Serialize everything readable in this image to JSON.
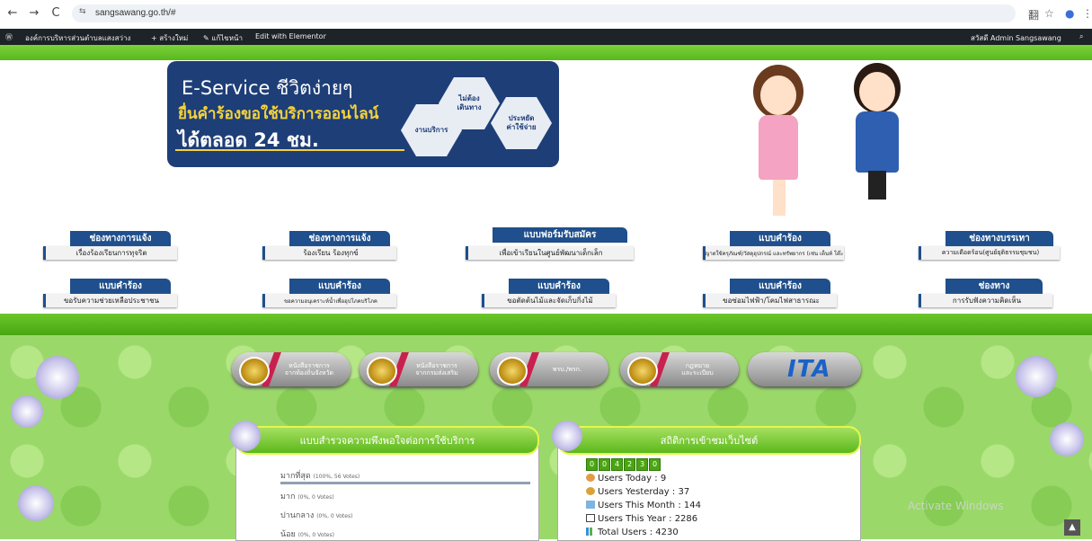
{
  "browser": {
    "url": "sangsawang.go.th/#",
    "back_icon": "←",
    "forward_icon": "→",
    "reload_icon": "C",
    "site_info_icon": "⇆",
    "translate_icon": "翻",
    "star_icon": "☆",
    "profile_icon": "●",
    "menu_icon": "⋮"
  },
  "adminbar": {
    "wp_icon": "Ⓦ",
    "site_name": "องค์การบริหารส่วนตำบลแสงสว่าง",
    "new_label": "+ สร้างใหม่",
    "edit_label": "✎ แก้ไขหน้า",
    "elementor_label": "Edit with Elementor",
    "howdy": "สวัสดี Admin Sangsawang",
    "search_icon": "⌕"
  },
  "banner": {
    "line1": "E-Service  ชีวิตง่ายๆ",
    "line2": "ยื่นคำร้องขอใช้บริการออนไลน์",
    "line3": "ได้ตลอด 24 ชม.",
    "hex1": "งานบริการ",
    "hex2": "ไม่ต้อง\nเดินทาง",
    "hex3": "ประหยัด\nค่าใช้จ่าย"
  },
  "menu": [
    {
      "top": "ช่องทางการแจ้ง",
      "bottom": "เรื่องร้องเรียนการทุจริต"
    },
    {
      "top": "ช่องทางการแจ้ง",
      "bottom": "ร้องเรียน ร้องทุกข์"
    },
    {
      "top": "แบบฟอร์มรับสมัคร",
      "bottom": "เพื่อเข้าเรียนในศูนย์พัฒนาเด็กเล็ก"
    },
    {
      "top": "แบบคำร้อง",
      "bottom": "ขออนุญาตใช้ครุภัณฑ์/วัสดุอุปกรณ์ และทรัพยากร (เช่น เต็นท์ โต๊ะ เก้าอี้)"
    },
    {
      "top": "ช่องทางบรรเทา",
      "bottom": "ความเดือดร้อน(ศูนย์ยุติธรรมชุมชน)"
    },
    {
      "top": "แบบคำร้อง",
      "bottom": "ขอรับความช่วยเหลือประชาชน"
    },
    {
      "top": "แบบคำร้อง",
      "bottom": "ขอความอนุเคราะห์น้ำเพื่ออุปโภคบริโภค"
    },
    {
      "top": "แบบคำร้อง",
      "bottom": "ขอตัดต้นไม้และจัดเก็บกิ่งไม้"
    },
    {
      "top": "แบบคำร้อง",
      "bottom": "ขอซ่อมไฟฟ้า/โคมไฟสาธารณะ"
    },
    {
      "top": "ช่องทาง",
      "bottom": "การรับฟังความคิดเห็น"
    }
  ],
  "links": [
    {
      "label": "หนังสือราชการ\nจากท้องถิ่นจังหวัด"
    },
    {
      "label": "หนังสือราชการ\nจากกรมส่งเสริม"
    },
    {
      "label": "พรบ./พรก."
    },
    {
      "label": "กฎหมาย\nและระเบียบ"
    }
  ],
  "ita_label": "ITA",
  "poll": {
    "title": "แบบสำรวจความพึงพอใจต่อการใช้บริการ",
    "options": [
      {
        "label": "มากที่สุด",
        "detail": "(100%, 56 Votes)",
        "percent": 100
      },
      {
        "label": "มาก",
        "detail": "(0%, 0 Votes)",
        "percent": 0
      },
      {
        "label": "ปานกลาง",
        "detail": "(0%, 0 Votes)",
        "percent": 0
      },
      {
        "label": "น้อย",
        "detail": "(0%, 0 Votes)",
        "percent": 0
      }
    ]
  },
  "stats": {
    "title": "สถิติการเข้าชมเว็บไซต์",
    "digits": [
      "0",
      "0",
      "4",
      "2",
      "3",
      "0"
    ],
    "today": "Users Today : 9",
    "yesterday": "Users Yesterday : 37",
    "month": "Users This Month : 144",
    "year": "Users This Year : 2286",
    "total": "Total Users : 4230"
  },
  "watermark": "Activate Windows",
  "totop_icon": "▲"
}
